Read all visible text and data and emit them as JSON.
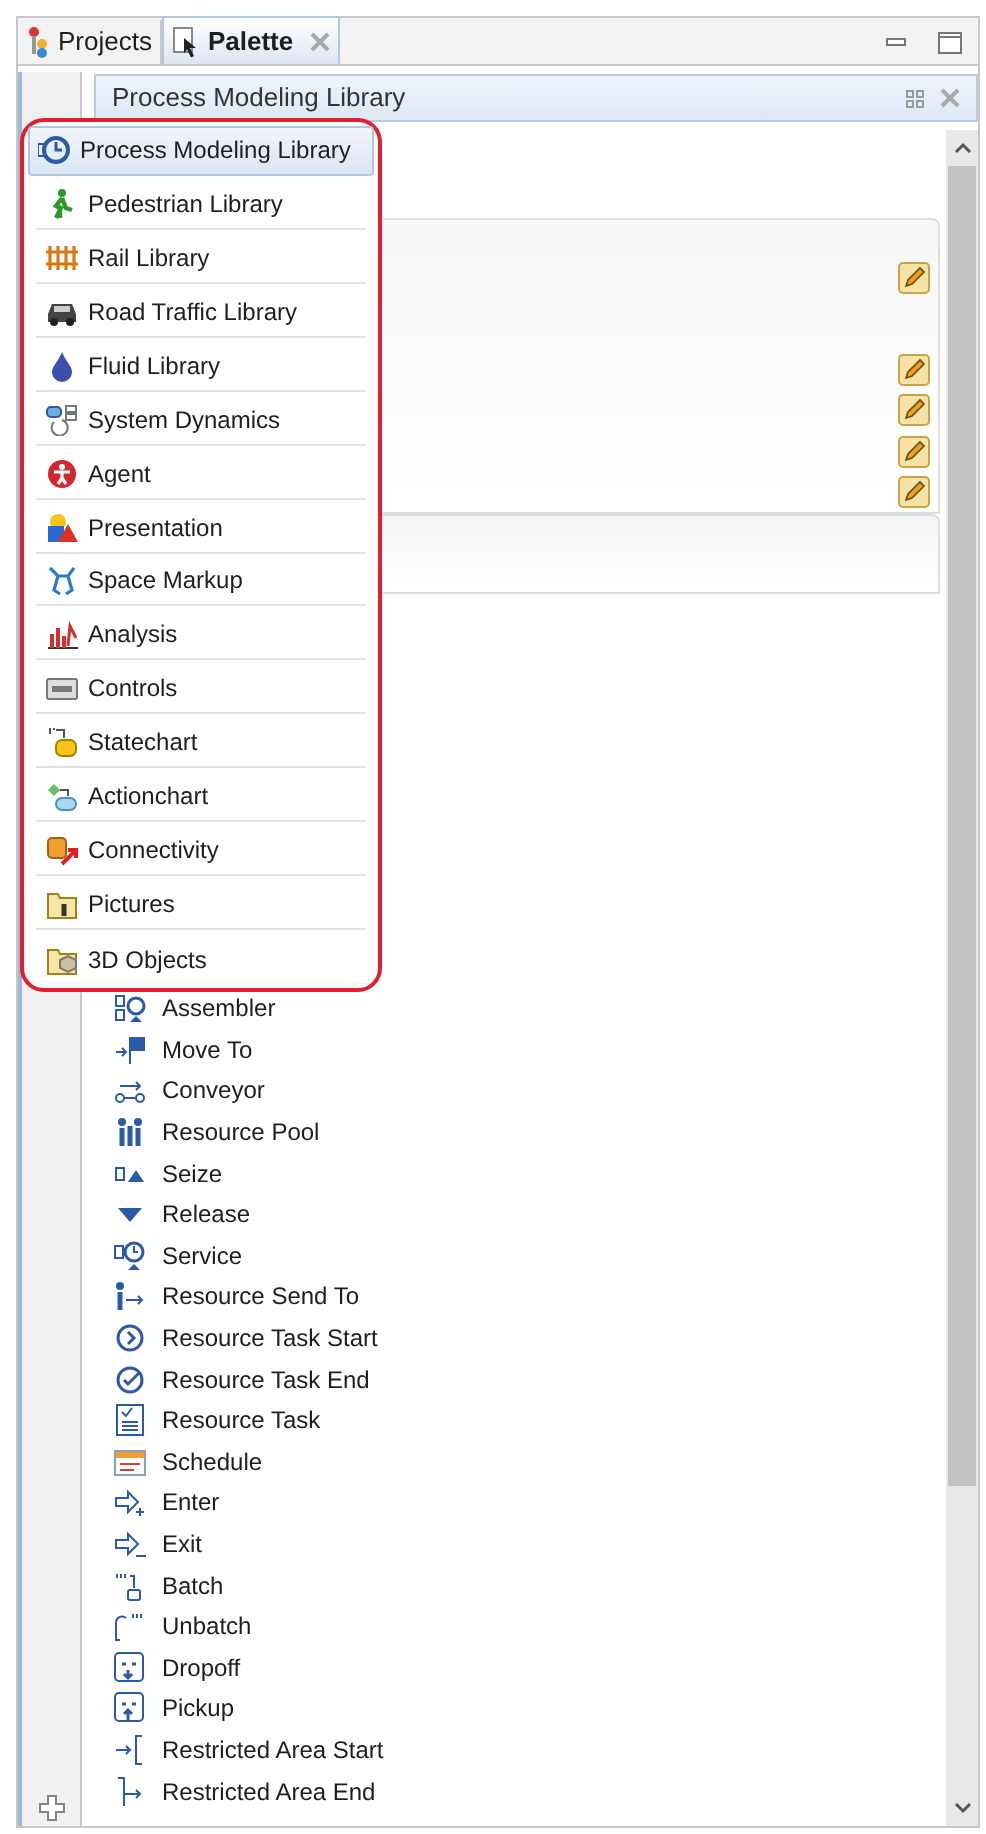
{
  "tabs": [
    {
      "label": "Projects",
      "selected": false
    },
    {
      "label": "Palette",
      "selected": true
    }
  ],
  "header": {
    "title": "Process Modeling Library"
  },
  "library_menu": [
    {
      "label": "Process Modeling Library",
      "selected": true
    },
    {
      "label": "Pedestrian Library",
      "selected": false
    },
    {
      "label": "Rail Library",
      "selected": false
    },
    {
      "label": "Road Traffic Library",
      "selected": false
    },
    {
      "label": "Fluid Library",
      "selected": false
    },
    {
      "label": "System Dynamics",
      "selected": false
    },
    {
      "label": "Agent",
      "selected": false
    },
    {
      "label": "Presentation",
      "selected": false
    },
    {
      "label": "Space Markup",
      "selected": false
    },
    {
      "label": "Analysis",
      "selected": false
    },
    {
      "label": "Controls",
      "selected": false
    },
    {
      "label": "Statechart",
      "selected": false
    },
    {
      "label": "Actionchart",
      "selected": false
    },
    {
      "label": "Connectivity",
      "selected": false
    },
    {
      "label": "Pictures",
      "selected": false
    },
    {
      "label": "3D Objects",
      "selected": false
    }
  ],
  "palette_items": [
    "Assembler",
    "Move To",
    "Conveyor",
    "Resource Pool",
    "Seize",
    "Release",
    "Service",
    "Resource Send To",
    "Resource Task Start",
    "Resource Task End",
    "Resource Task",
    "Schedule",
    "Enter",
    "Exit",
    "Batch",
    "Unbatch",
    "Dropoff",
    "Pickup",
    "Restricted Area Start",
    "Restricted Area End"
  ]
}
